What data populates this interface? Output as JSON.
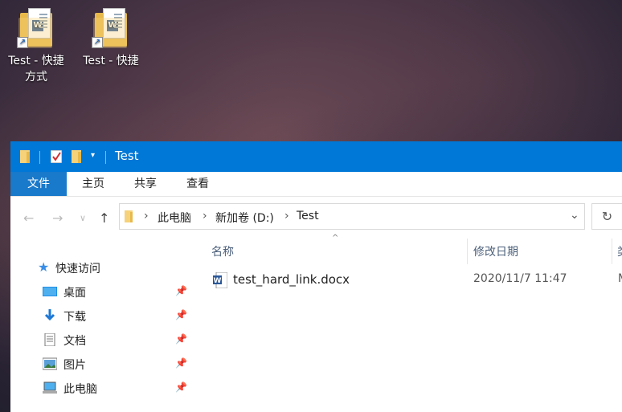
{
  "desktop": {
    "icons": [
      {
        "label_line1": "Test - 快捷",
        "label_line2": "方式"
      },
      {
        "label_line1": "Test - 快捷",
        "label_line2": ""
      }
    ]
  },
  "window": {
    "title": "Test",
    "ribbon_tabs": [
      "文件",
      "主页",
      "共享",
      "查看"
    ],
    "breadcrumb": [
      "此电脑",
      "新加卷 (D:)",
      "Test"
    ],
    "nav_pane": {
      "quick_access": "快速访问",
      "items": [
        "桌面",
        "下载",
        "文档",
        "图片",
        "此电脑"
      ]
    },
    "columns": [
      "名称",
      "修改日期",
      "类"
    ],
    "files": [
      {
        "name": "test_hard_link.docx",
        "modified": "2020/11/7 11:47",
        "type": "M"
      }
    ]
  },
  "colors": {
    "accent": "#0078d7",
    "active_tab": "#1979ca",
    "column_header": "#4c607a"
  }
}
